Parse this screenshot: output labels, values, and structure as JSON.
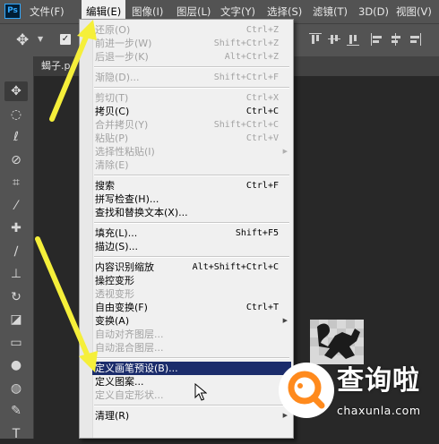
{
  "app": {
    "logo": "Ps"
  },
  "menubar": {
    "items": [
      {
        "label": "文件(F)",
        "active": false
      },
      {
        "label": "编辑(E)",
        "active": true
      },
      {
        "label": "图像(I)",
        "active": false
      },
      {
        "label": "图层(L)",
        "active": false
      },
      {
        "label": "文字(Y)",
        "active": false
      },
      {
        "label": "选择(S)",
        "active": false
      },
      {
        "label": "滤镜(T)",
        "active": false
      },
      {
        "label": "3D(D)",
        "active": false
      },
      {
        "label": "视图(V)",
        "active": false
      }
    ]
  },
  "options_bar": {
    "tool_icon": "move-icon",
    "checkbox_checked": true,
    "align_icons": [
      "align-top-icon",
      "align-vcenter-icon",
      "align-bottom-icon",
      "align-left-icon",
      "align-hcenter-icon",
      "align-right-icon"
    ]
  },
  "document": {
    "tab_label": "蝎子.p"
  },
  "toolbar": {
    "tools": [
      "move-icon",
      "marquee-icon",
      "lasso-icon",
      "quick-select-icon",
      "crop-icon",
      "eyedropper-icon",
      "healing-icon",
      "brush-icon",
      "stamp-icon",
      "history-brush-icon",
      "eraser-icon",
      "gradient-icon",
      "blur-icon",
      "dodge-icon",
      "pen-icon",
      "type-icon"
    ],
    "tool_glyphs": [
      "✥",
      "◌",
      "ℓ",
      "⊘",
      "⌗",
      "⁄",
      "✚",
      "∕",
      "⊥",
      "↻",
      "◪",
      "▭",
      "●",
      "◍",
      "✎",
      "T"
    ]
  },
  "edit_menu": {
    "items": [
      {
        "label": "还原(O)",
        "shortcut": "Ctrl+Z",
        "disabled": true
      },
      {
        "label": "前进一步(W)",
        "shortcut": "Shift+Ctrl+Z",
        "disabled": true
      },
      {
        "label": "后退一步(K)",
        "shortcut": "Alt+Ctrl+Z",
        "disabled": true
      },
      {
        "separator": true
      },
      {
        "label": "渐隐(D)...",
        "shortcut": "Shift+Ctrl+F",
        "disabled": true
      },
      {
        "separator": true
      },
      {
        "label": "剪切(T)",
        "shortcut": "Ctrl+X",
        "disabled": true
      },
      {
        "label": "拷贝(C)",
        "shortcut": "Ctrl+C",
        "disabled": false
      },
      {
        "label": "合并拷贝(Y)",
        "shortcut": "Shift+Ctrl+C",
        "disabled": true
      },
      {
        "label": "粘贴(P)",
        "shortcut": "Ctrl+V",
        "disabled": true
      },
      {
        "label": "选择性粘贴(I)",
        "shortcut": "",
        "disabled": true,
        "submenu": true
      },
      {
        "label": "清除(E)",
        "shortcut": "",
        "disabled": true
      },
      {
        "separator": true
      },
      {
        "label": "搜索",
        "shortcut": "Ctrl+F",
        "disabled": false
      },
      {
        "label": "拼写检查(H)...",
        "shortcut": "",
        "disabled": false
      },
      {
        "label": "查找和替换文本(X)...",
        "shortcut": "",
        "disabled": false
      },
      {
        "separator": true
      },
      {
        "label": "填充(L)...",
        "shortcut": "Shift+F5",
        "disabled": false
      },
      {
        "label": "描边(S)...",
        "shortcut": "",
        "disabled": false
      },
      {
        "separator": true
      },
      {
        "label": "内容识别缩放",
        "shortcut": "Alt+Shift+Ctrl+C",
        "disabled": false
      },
      {
        "label": "操控变形",
        "shortcut": "",
        "disabled": false
      },
      {
        "label": "透视变形",
        "shortcut": "",
        "disabled": true
      },
      {
        "label": "自由变换(F)",
        "shortcut": "Ctrl+T",
        "disabled": false
      },
      {
        "label": "变换(A)",
        "shortcut": "",
        "disabled": false,
        "submenu": true
      },
      {
        "label": "自动对齐图层...",
        "shortcut": "",
        "disabled": true
      },
      {
        "label": "自动混合图层...",
        "shortcut": "",
        "disabled": true
      },
      {
        "separator": true
      },
      {
        "label": "定义画笔预设(B)...",
        "shortcut": "",
        "disabled": false,
        "highlighted": true
      },
      {
        "label": "定义图案...",
        "shortcut": "",
        "disabled": false
      },
      {
        "label": "定义自定形状...",
        "shortcut": "",
        "disabled": true
      },
      {
        "separator": true
      },
      {
        "label": "清理(R)",
        "shortcut": "",
        "disabled": false,
        "submenu": true
      }
    ]
  },
  "watermark": {
    "brand": "查询啦",
    "domain": "chaxunla.com"
  },
  "colors": {
    "menubar": "#535353",
    "highlight": "#1b2c6b",
    "arrow": "#f5ef3a",
    "canvas": "#282828"
  }
}
